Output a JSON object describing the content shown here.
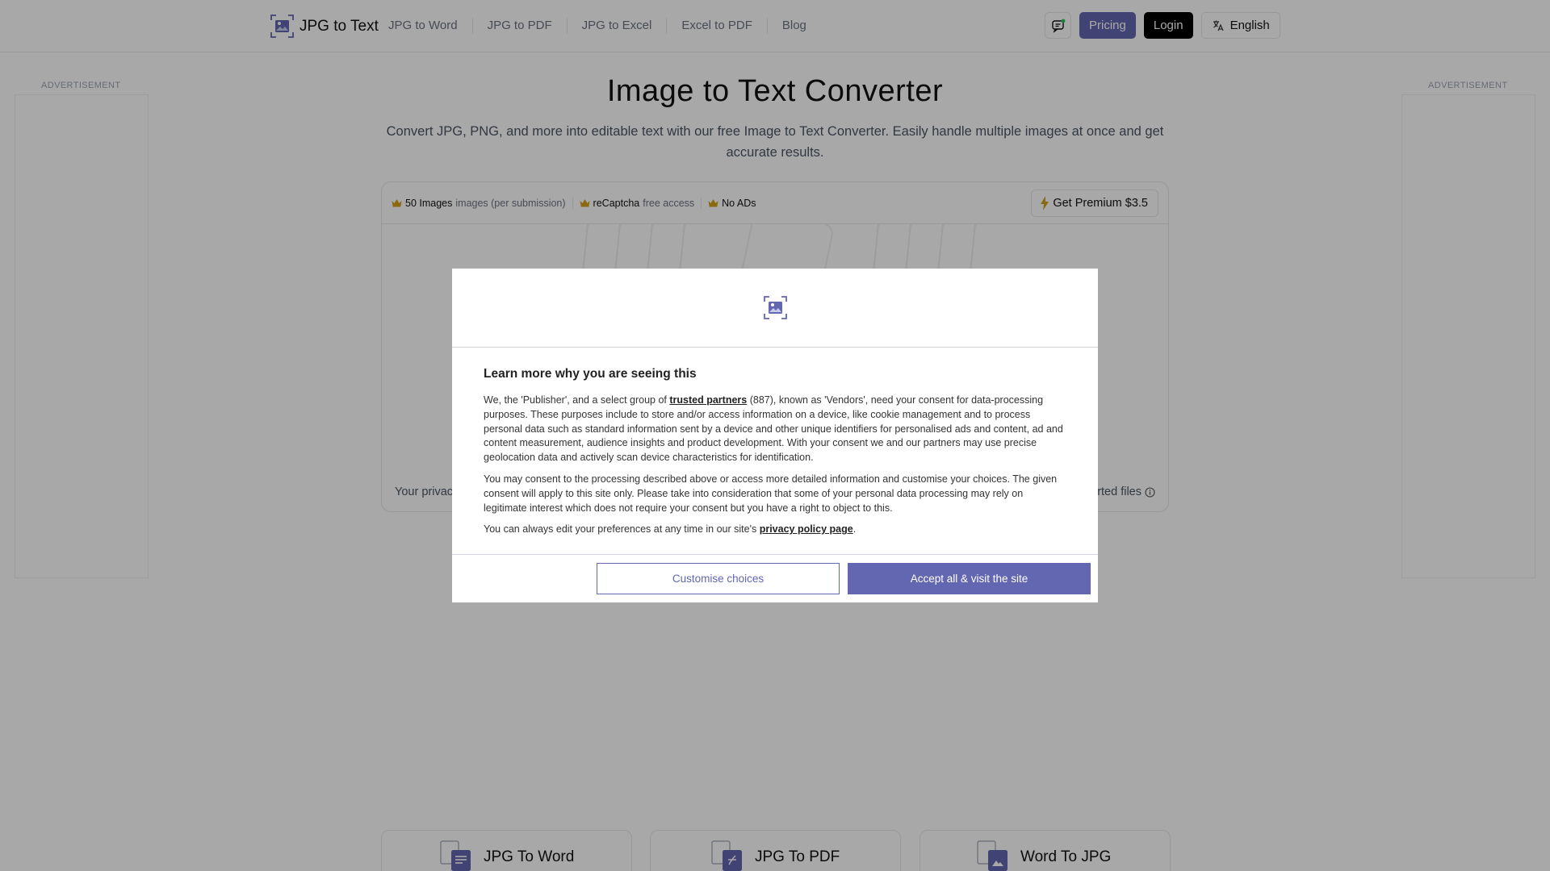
{
  "header": {
    "logo_text": "JPG to Text",
    "nav": [
      "JPG to Word",
      "JPG to PDF",
      "JPG to Excel",
      "Excel to PDF",
      "Blog"
    ],
    "pricing_label": "Pricing",
    "login_label": "Login",
    "language_label": "English"
  },
  "ads": {
    "left_label": "ADVERTISEMENT",
    "right_label": "ADVERTISEMENT"
  },
  "hero": {
    "title": "Image to Text Converter",
    "subtitle": "Convert JPG, PNG, and more into editable text with our free Image to Text Converter. Easily handle multiple images at once and get accurate results."
  },
  "tool": {
    "features": [
      {
        "strong": "50 Images",
        "muted": "images (per submission)"
      },
      {
        "strong": "reCaptcha",
        "muted": "free access"
      },
      {
        "strong": "No ADs",
        "muted": ""
      }
    ],
    "premium_label": "Get Premium $3.5",
    "privacy_left": "Your privac",
    "privacy_right": "rted files"
  },
  "tool_cards": [
    "JPG To Word",
    "JPG To PDF",
    "Word To JPG"
  ],
  "consent": {
    "heading": "Learn more why you are seeing this",
    "p1_before": "We, the 'Publisher', and a select group of ",
    "p1_link": "trusted partners",
    "p1_after": " (887), known as 'Vendors', need your consent for data-processing purposes. These purposes include to store and/or access information on a device, like cookie management and to process personal data such as standard information sent by a device and other unique identifiers for personalised ads and content, ad and content measurement, audience insights and product development. With your consent we and our partners may use precise geolocation data and actively scan device characteristics for identification.",
    "p2": "You may consent to the processing described above or access more detailed information and customise your choices. The given consent will apply to this site only. Please take into consideration that some of your personal data processing may rely on legitimate interest which does not require your consent but you have a right to object to this.",
    "p3_before": "You can always edit your preferences at any time in our site's ",
    "p3_link": "privacy policy page",
    "p3_after": ".",
    "customise_label": "Customise choices",
    "accept_label": "Accept all & visit the site"
  },
  "colors": {
    "accent": "#6366b1",
    "crown": "#d4a017"
  }
}
